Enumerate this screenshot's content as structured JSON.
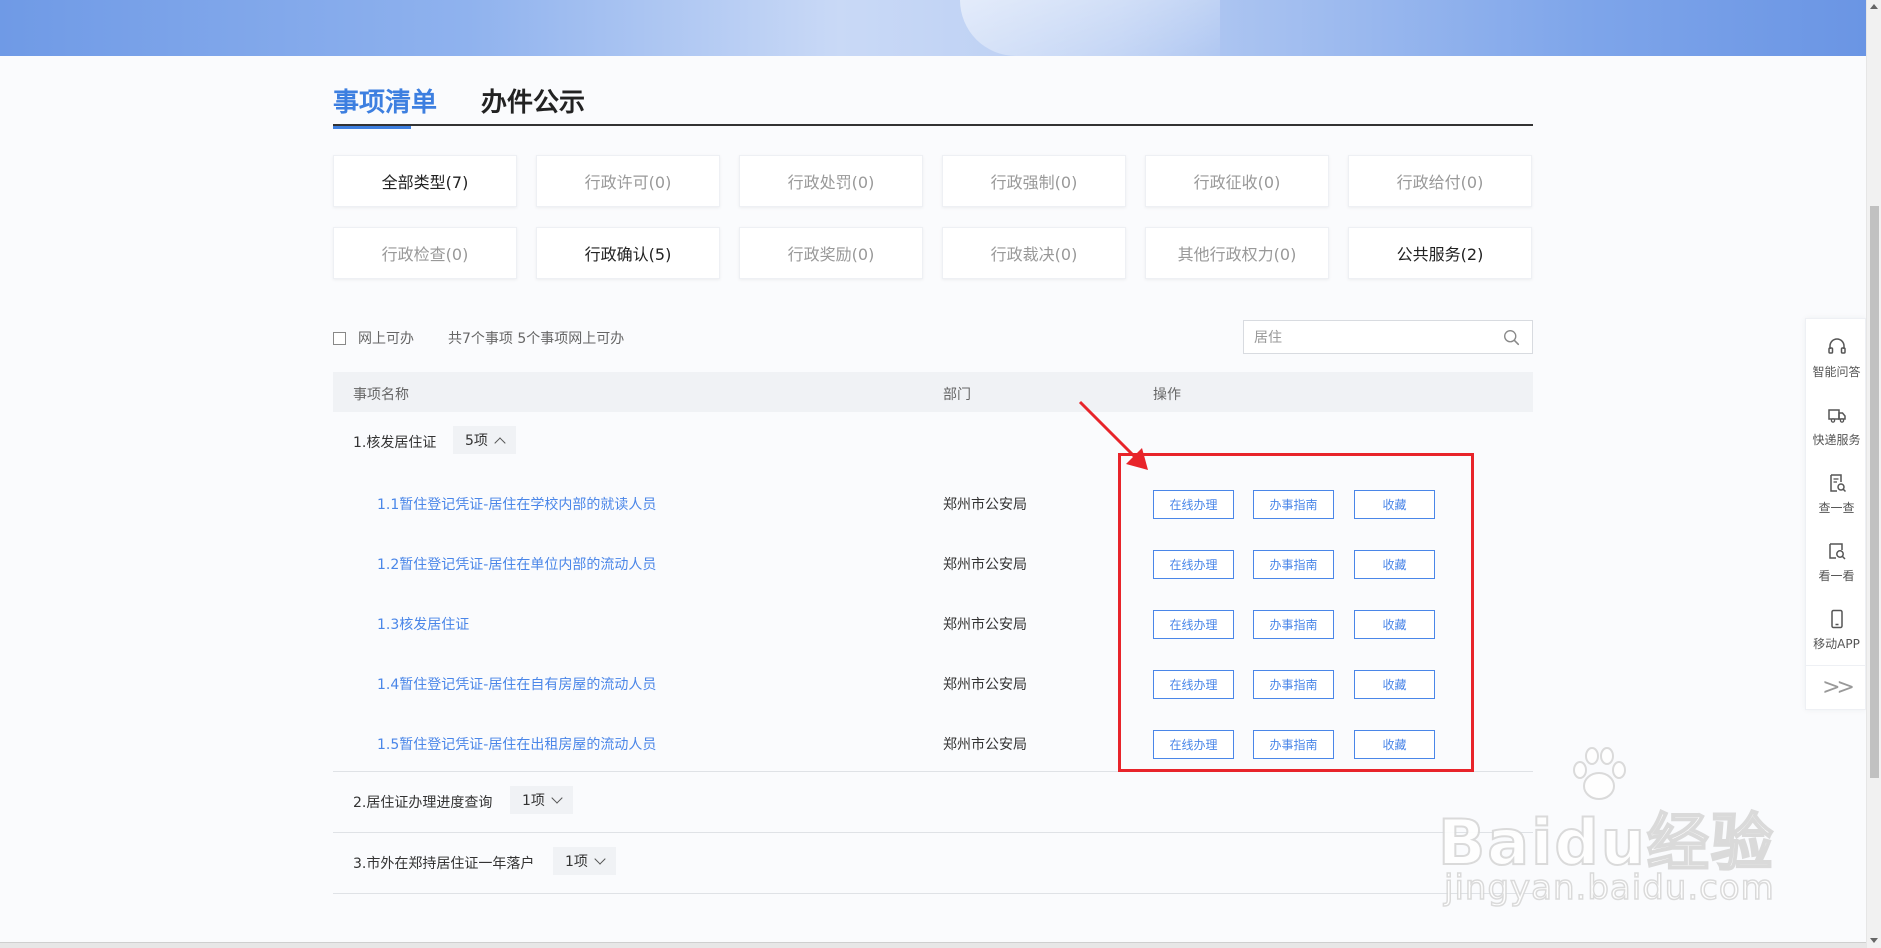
{
  "tabs": [
    {
      "label": "事项清单",
      "active": true
    },
    {
      "label": "办件公示",
      "active": false
    }
  ],
  "categories": [
    {
      "label": "全部类型(7)",
      "enabled": true
    },
    {
      "label": "行政许可(0)",
      "enabled": false
    },
    {
      "label": "行政处罚(0)",
      "enabled": false
    },
    {
      "label": "行政强制(0)",
      "enabled": false
    },
    {
      "label": "行政征收(0)",
      "enabled": false
    },
    {
      "label": "行政给付(0)",
      "enabled": false
    },
    {
      "label": "行政检查(0)",
      "enabled": false
    },
    {
      "label": "行政确认(5)",
      "enabled": true
    },
    {
      "label": "行政奖励(0)",
      "enabled": false
    },
    {
      "label": "行政裁决(0)",
      "enabled": false
    },
    {
      "label": "其他行政权力(0)",
      "enabled": false
    },
    {
      "label": "公共服务(2)",
      "enabled": true
    }
  ],
  "filter": {
    "online_label": "网上可办",
    "summary": "共7个事项 5个事项网上可办"
  },
  "search": {
    "value": "居住",
    "icon": "search-icon"
  },
  "table": {
    "headers": {
      "name": "事项名称",
      "dept": "部门",
      "action": "操作"
    }
  },
  "groups": [
    {
      "name": "1.核发居住证",
      "count": "5项",
      "expanded": true,
      "items": [
        {
          "name": "1.1暂住登记凭证-居住在学校内部的就读人员",
          "dept": "郑州市公安局"
        },
        {
          "name": "1.2暂住登记凭证-居住在单位内部的流动人员",
          "dept": "郑州市公安局"
        },
        {
          "name": "1.3核发居住证",
          "dept": "郑州市公安局"
        },
        {
          "name": "1.4暂住登记凭证-居住在自有房屋的流动人员",
          "dept": "郑州市公安局"
        },
        {
          "name": "1.5暂住登记凭证-居住在出租房屋的流动人员",
          "dept": "郑州市公安局"
        }
      ]
    },
    {
      "name": "2.居住证办理进度查询",
      "count": "1项",
      "expanded": false,
      "items": []
    },
    {
      "name": "3.市外在郑持居住证一年落户",
      "count": "1项",
      "expanded": false,
      "items": []
    }
  ],
  "actions": {
    "online": "在线办理",
    "guide": "办事指南",
    "favorite": "收藏"
  },
  "sidebar": [
    {
      "label": "智能问答",
      "icon": "headset-icon"
    },
    {
      "label": "快递服务",
      "icon": "truck-icon"
    },
    {
      "label": "查一查",
      "icon": "doc-search-icon"
    },
    {
      "label": "看一看",
      "icon": "view-icon"
    },
    {
      "label": "移动APP",
      "icon": "phone-icon"
    }
  ],
  "sidebar_expand": ">>",
  "watermark": {
    "brand": "Baidu经验",
    "url": "jingyan.baidu.com"
  },
  "colors": {
    "accent": "#4a86e8",
    "highlight": "#e8242a",
    "tab_active": "#3d7fe0"
  }
}
